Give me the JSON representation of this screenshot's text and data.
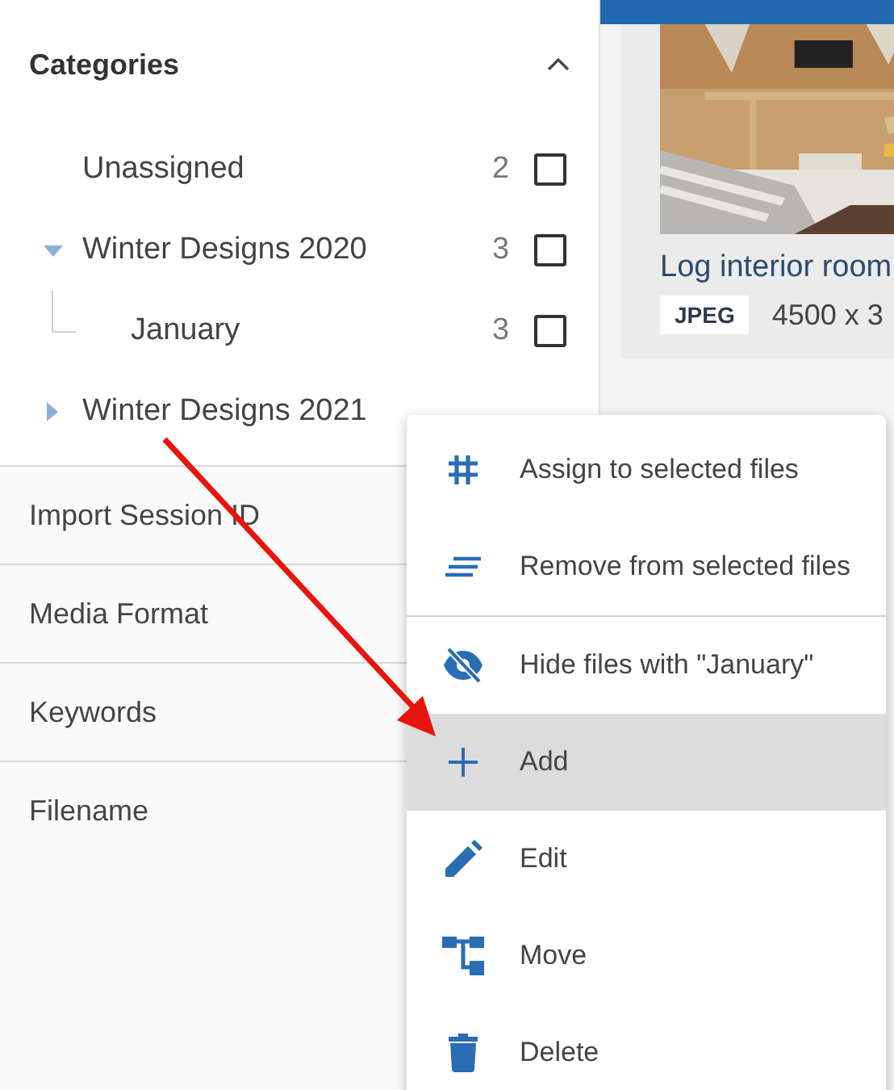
{
  "sidebar": {
    "categories": {
      "title": "Categories",
      "expanded": true,
      "tree": [
        {
          "label": "Unassigned",
          "count": "2",
          "checked": false
        },
        {
          "label": "Winter Designs 2020",
          "count": "3",
          "checked": false,
          "expanded": true,
          "children": [
            {
              "label": "January",
              "count": "3",
              "checked": false
            }
          ]
        },
        {
          "label": "Winter Designs 2021",
          "expanded": false
        }
      ]
    },
    "sections": [
      {
        "title": "Import Session ID"
      },
      {
        "title": "Media Format"
      },
      {
        "title": "Keywords"
      },
      {
        "title": "Filename"
      }
    ]
  },
  "cards": [
    {
      "title": "Log interior room",
      "format": "JPEG",
      "dimensions": "4500 x 3"
    }
  ],
  "context_menu": {
    "items": [
      {
        "label": "Assign to selected files",
        "selected": false
      },
      {
        "label": "Remove from selected files",
        "selected": false
      },
      {
        "label": "Hide files with \"January\"",
        "selected": false
      },
      {
        "label": "Add",
        "selected": true
      },
      {
        "label": "Edit",
        "selected": false
      },
      {
        "label": "Move",
        "selected": false
      },
      {
        "label": "Delete",
        "selected": false
      }
    ]
  }
}
